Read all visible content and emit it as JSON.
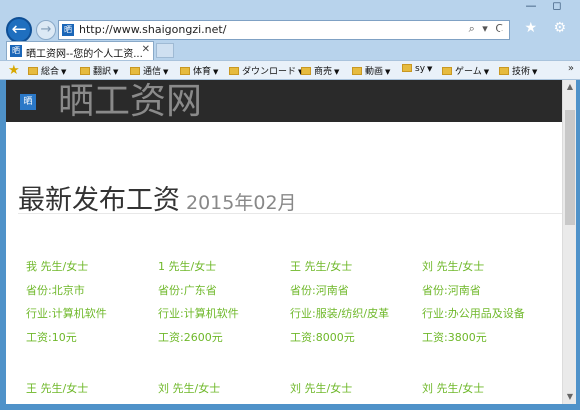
{
  "browser": {
    "url": "http://www.shaigongzi.net/",
    "tab_title": "晒工资网--您的个人工资...",
    "favicon_text": "晒",
    "address_tools": "⌕ ▾ C",
    "window_buttons": [
      "—",
      "◻"
    ],
    "right_icons": "⌂ ★ ⚙",
    "favorites": [
      {
        "label": "総合"
      },
      {
        "label": "翻訳"
      },
      {
        "label": "通信"
      },
      {
        "label": "体育"
      },
      {
        "label": "ダウンロード"
      },
      {
        "label": "商売"
      },
      {
        "label": "動画"
      },
      {
        "label": "sy"
      },
      {
        "label": "ゲーム"
      },
      {
        "label": "技術"
      }
    ]
  },
  "site": {
    "logo_text": "晒",
    "title": "晒工资网"
  },
  "heading": {
    "main": "最新发布工资",
    "sub": "2015年02月"
  },
  "cards": [
    {
      "name": "我 先生/女士",
      "province": "省份:北京市",
      "industry": "行业:计算机软件",
      "salary": "工资:10元"
    },
    {
      "name": "1 先生/女士",
      "province": "省份:广东省",
      "industry": "行业:计算机软件",
      "salary": "工资:2600元"
    },
    {
      "name": "王 先生/女士",
      "province": "省份:河南省",
      "industry": "行业:服装/纺织/皮革",
      "salary": "工资:8000元"
    },
    {
      "name": "刘 先生/女士",
      "province": "省份:河南省",
      "industry": "行业:办公用品及设备",
      "salary": "工资:3800元"
    },
    {
      "name": "王 先生/女士"
    },
    {
      "name": "刘 先生/女士"
    },
    {
      "name": "刘 先生/女士"
    },
    {
      "name": "刘 先生/女士"
    }
  ],
  "colors": {
    "accent_green": "#6fb82a",
    "header_bg": "#2a2a2a",
    "chrome_blue": "#4f92c9"
  }
}
